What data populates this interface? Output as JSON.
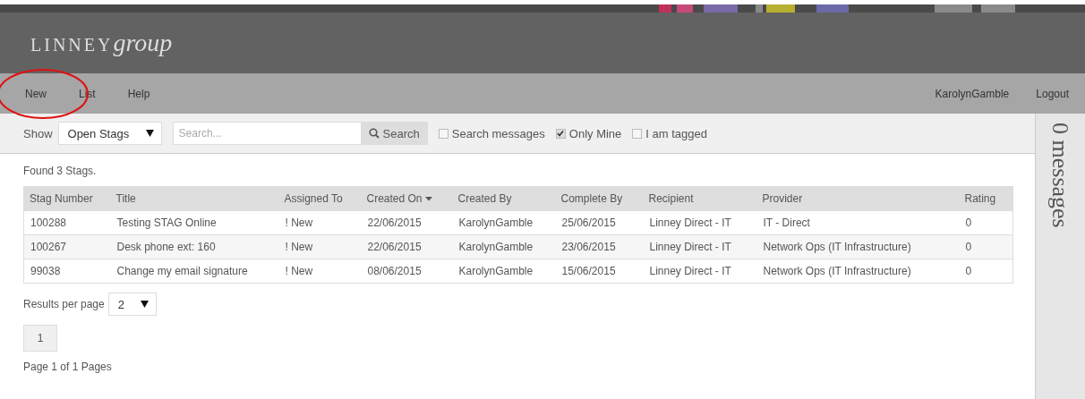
{
  "header": {
    "logo_name": "LINNEY",
    "logo_suffix": "group"
  },
  "nav": {
    "items": [
      "New",
      "List",
      "Help"
    ],
    "user": "KarolynGamble",
    "logout": "Logout"
  },
  "toolbar": {
    "show_label": "Show",
    "filter": "Open Stags",
    "search": {
      "placeholder": "Search..."
    },
    "search_button": "Search",
    "options": [
      {
        "label": "Search messages",
        "checked": false
      },
      {
        "label": "Only Mine",
        "checked": true
      },
      {
        "label": "I am tagged",
        "checked": false
      }
    ]
  },
  "found": "Found 3 Stags.",
  "table": {
    "columns": [
      {
        "label": "Stag Number",
        "sorted": false
      },
      {
        "label": "Title",
        "sorted": false
      },
      {
        "label": "Assigned To",
        "sorted": false
      },
      {
        "label": "Created On",
        "sorted": true
      },
      {
        "label": "Created By",
        "sorted": false
      },
      {
        "label": "Complete By",
        "sorted": false
      },
      {
        "label": "Recipient",
        "sorted": false
      },
      {
        "label": "Provider",
        "sorted": false
      },
      {
        "label": "Rating",
        "sorted": false
      }
    ],
    "rows": [
      [
        "100288",
        "Testing STAG Online",
        "! New",
        "22/06/2015",
        "KarolynGamble",
        "25/06/2015",
        "Linney Direct - IT",
        "IT - Direct",
        "0"
      ],
      [
        "100267",
        "Desk phone ext: 160",
        "! New",
        "22/06/2015",
        "KarolynGamble",
        "23/06/2015",
        "Linney Direct - IT",
        "Network Ops (IT Infrastructure)",
        "0"
      ],
      [
        "99038",
        "Change my email signature",
        "! New",
        "08/06/2015",
        "KarolynGamble",
        "15/06/2015",
        "Linney Direct - IT",
        "Network Ops (IT Infrastructure)",
        "0"
      ]
    ]
  },
  "results_per_page": {
    "label": "Results per page",
    "value": "2"
  },
  "pages": [
    "1"
  ],
  "page_info": "Page 1 of 1 Pages",
  "messages_panel": "0 messages"
}
